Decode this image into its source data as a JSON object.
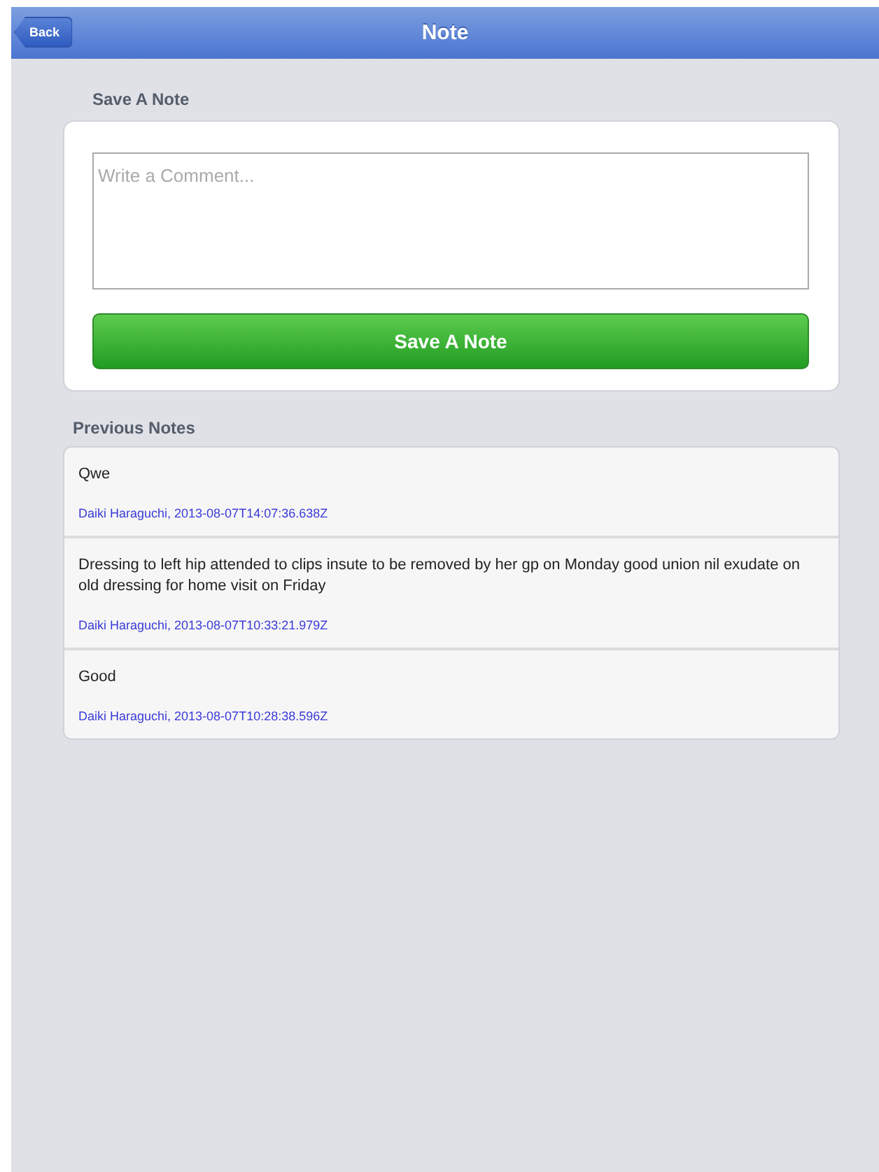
{
  "nav_bar": {
    "back_button": "Back",
    "title": "Note"
  },
  "save_section": {
    "heading": "Save A Note",
    "comment_field": {
      "placeholder": "Write a Comment..."
    },
    "save_button": "Save A Note"
  },
  "previous_notes": {
    "heading": "Previous Notes",
    "notes": [
      {
        "text": "Qwe",
        "meta": "Daiki Haraguchi, 2013-08-07T14:07:36.638Z"
      },
      {
        "text": "Dressing to left hip attended to clips insute to be removed by her gp on Monday good union nil exudate on old dressing for home visit on Friday",
        "meta": "Daiki Haraguchi, 2013-08-07T10:33:21.979Z"
      },
      {
        "text": "Good",
        "meta": "Daiki Haraguchi, 2013-08-07T10:28:38.596Z"
      }
    ]
  }
}
